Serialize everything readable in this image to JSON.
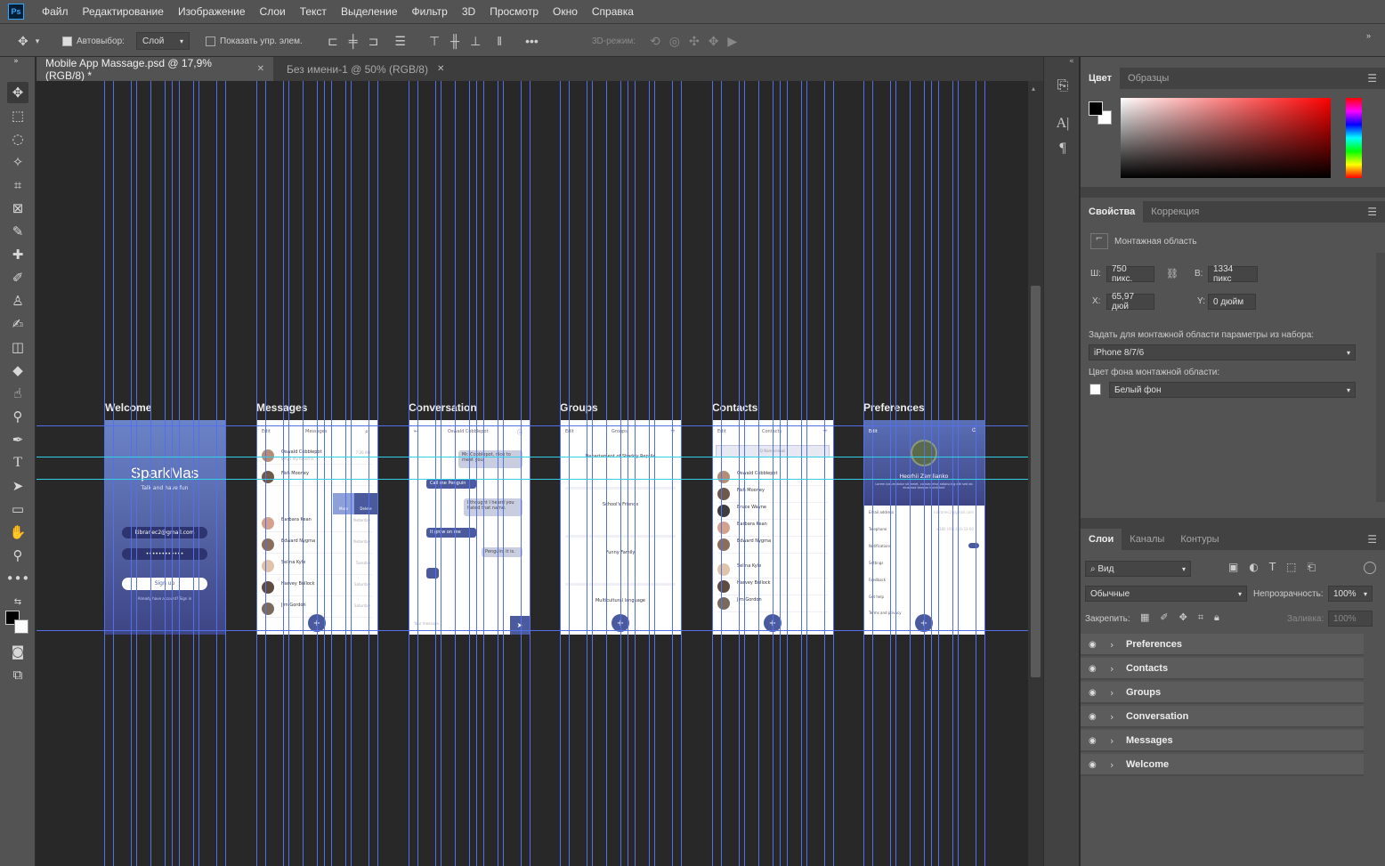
{
  "app": {
    "logo": "Ps"
  },
  "menu": [
    "Файл",
    "Редактирование",
    "Изображение",
    "Слои",
    "Текст",
    "Выделение",
    "Фильтр",
    "3D",
    "Просмотр",
    "Окно",
    "Справка"
  ],
  "options": {
    "auto_select_label": "Автовыбор:",
    "auto_select_value": "Слой",
    "show_transform_label": "Показать упр. элем.",
    "mode_3d_label": "3D-режим:"
  },
  "tabs": [
    {
      "label": "Mobile App Massage.psd @ 17,9% (RGB/8) *",
      "active": true
    },
    {
      "label": "Без имени-1 @ 50% (RGB/8)",
      "active": false
    }
  ],
  "artboards": [
    {
      "name": "Welcome"
    },
    {
      "name": "Messages"
    },
    {
      "name": "Conversation"
    },
    {
      "name": "Groups"
    },
    {
      "name": "Contacts"
    },
    {
      "name": "Preferences"
    }
  ],
  "mock": {
    "welcome": {
      "brand": "SparkMas",
      "tagline": "Talk and have fun",
      "email": "kibranec2@gmail.com",
      "password": "••••••••••••",
      "button": "Sign up",
      "footer": "Already have account? Sign in"
    },
    "messages": {
      "edit": "Edit",
      "title": "Messages",
      "rows": [
        {
          "name": "Oswald Cobblepot",
          "sub": "Why I my friend is",
          "time": "7:20 AM"
        },
        {
          "name": "Fish Mooney",
          "sub": "",
          "time": "Yesterday"
        },
        {
          "name": "Barbara Kean",
          "sub": "",
          "time": "Yesterday"
        },
        {
          "name": "Edward Nygma",
          "sub": "",
          "time": "Yesterday"
        },
        {
          "name": "Selina Kyle",
          "sub": "",
          "time": "Tuesday"
        },
        {
          "name": "Harvey Bullock",
          "sub": "",
          "time": "Saturday"
        },
        {
          "name": "Jim Gordon",
          "sub": "",
          "time": "Saturday"
        }
      ],
      "more": "More",
      "delete": "Delete"
    },
    "conversation": {
      "title": "Oswald Cobblepot",
      "bubbles": [
        "Mr. Cobblepot, nice to meet you!",
        "Call me Penguin",
        "I thought I heard you hated that name.",
        "It grow on me",
        "Penguin, it is."
      ],
      "input": "Your message..."
    },
    "groups": {
      "edit": "Edit",
      "title": "Groups",
      "items": [
        "Departament of Sharkly Reptile",
        "School's Friends",
        "Funny Family",
        "Multicultural language"
      ]
    },
    "contacts": {
      "edit": "Edit",
      "title": "Contacts",
      "search": "Q Name/email",
      "names": [
        "Oswald Cobblepot",
        "Fish Mooney",
        "Bruce Wayne",
        "Barbara Kean",
        "Edward Nygma",
        "Selina Kyle",
        "Harvey Bullock",
        "Jim Gordon"
      ]
    },
    "preferences": {
      "edit": "Edit",
      "name": "Heorhii Zemlianko",
      "bio": "Lorem ipsum dolor sit amet, consectetur adipiscing elit sed do eiusmod tempor incididunt",
      "rows": [
        "Email address",
        "Telephone",
        "Notifications",
        "Settings",
        "Feedback",
        "Get help",
        "Terms and privacy"
      ],
      "email_value": "kibranec2@gmail.com",
      "phone_value": "+380 (95) 456-33-00"
    }
  },
  "panels": {
    "color": {
      "tabs": [
        "Цвет",
        "Образцы"
      ]
    },
    "properties": {
      "tabs": [
        "Свойства",
        "Коррекция"
      ],
      "type": "Монтажная область",
      "w_label": "Ш:",
      "w_value": "750 пикс.",
      "h_label": "В:",
      "h_value": "1334 пикс",
      "x_label": "X:",
      "x_value": "65,97 дюй",
      "y_label": "Y:",
      "y_value": "0 дюйм",
      "preset_label": "Задать для монтажной области параметры из набора:",
      "preset_value": "iPhone 8/7/6",
      "bg_label": "Цвет фона монтажной области:",
      "bg_value": "Белый фон"
    },
    "layers": {
      "tabs": [
        "Слои",
        "Каналы",
        "Контуры"
      ],
      "filter": "Вид",
      "blend": "Обычные",
      "opacity_label": "Непрозрачность:",
      "opacity_value": "100%",
      "lock_label": "Закрепить:",
      "fill_label": "Заливка:",
      "fill_value": "100%",
      "items": [
        "Preferences",
        "Contacts",
        "Groups",
        "Conversation",
        "Messages",
        "Welcome"
      ]
    }
  },
  "colors": {
    "accent_blue": "#5470e8",
    "guide_cyan": "#2fd0e8",
    "welcome_top": "#6b84c7",
    "welcome_bottom": "#3e4585",
    "fab": "#4a5a9c"
  }
}
